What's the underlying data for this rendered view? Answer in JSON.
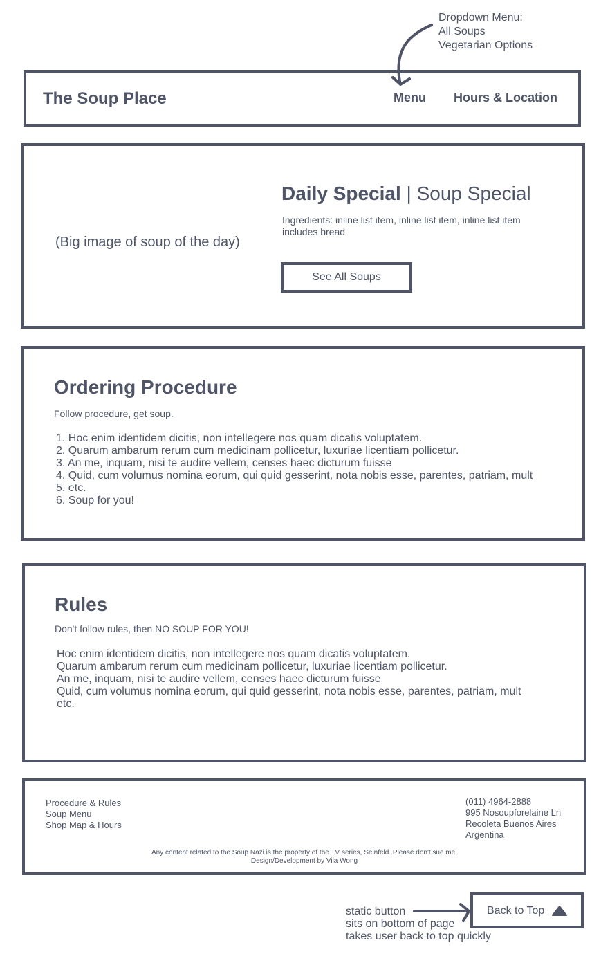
{
  "annotations": {
    "dropdown": [
      "Dropdown Menu:",
      "All Soups",
      "Vegetarian Options"
    ],
    "static_button": [
      "static button",
      "sits on bottom of page",
      "takes user back to top quickly"
    ]
  },
  "header": {
    "title": "The Soup Place",
    "nav": {
      "menu": "Menu",
      "hours": "Hours & Location"
    }
  },
  "hero": {
    "image_placeholder": "(Big image of soup of the day)",
    "heading_bold": "Daily Special",
    "heading_sep": " | ",
    "heading_light": "Soup Special",
    "ingredients": "Ingredients: inline list item, inline list item, inline list item includes bread",
    "button": "See All Soups"
  },
  "ordering": {
    "title": "Ordering Procedure",
    "subtitle": "Follow procedure, get soup.",
    "items": [
      "1. Hoc enim identidem dicitis, non intellegere nos quam dicatis voluptatem.",
      "2. Quarum ambarum rerum cum medicinam pollicetur, luxuriae licentiam pollicetur.",
      "3. An me, inquam, nisi te audire vellem, censes haec dicturum fuisse",
      "4. Quid, cum volumus nomina eorum, qui quid gesserint, nota nobis esse, parentes, patriam, mult",
      "5. etc.",
      "6. Soup for you!"
    ]
  },
  "rules": {
    "title": "Rules",
    "subtitle": "Don't follow rules, then NO SOUP FOR YOU!",
    "items": [
      "Hoc enim identidem dicitis, non intellegere nos quam dicatis voluptatem.",
      "Quarum ambarum rerum cum medicinam pollicetur, luxuriae licentiam pollicetur.",
      "An me, inquam, nisi te audire vellem, censes haec dicturum fuisse",
      "Quid, cum volumus nomina eorum, qui quid gesserint, nota nobis esse, parentes, patriam, mult",
      "etc."
    ]
  },
  "footer": {
    "links": [
      "Procedure & Rules",
      "Soup Menu",
      "Shop Map & Hours"
    ],
    "contact": [
      "(011) 4964-2888",
      "995 Nosoupforelaine Ln",
      "Recoleta Buenos Aires",
      "Argentina"
    ],
    "legal": "Any content related to the Soup Nazi is the property of the TV series, Seinfeld. Please don't sue me.",
    "credit": "Design/Development by Vila Wong"
  },
  "back_to_top": {
    "label": "Back to Top",
    "icon": "triangle-up-icon"
  },
  "colors": {
    "ink": "#4f5566",
    "background": "#ffffff"
  }
}
